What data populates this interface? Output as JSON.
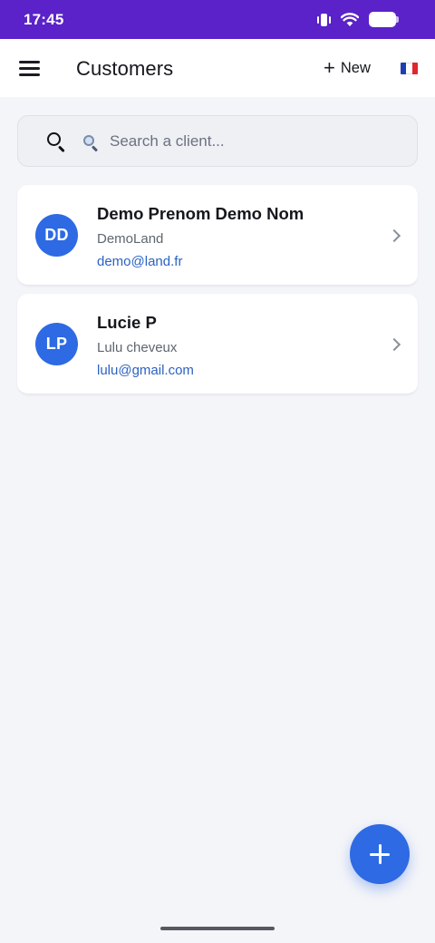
{
  "status_bar": {
    "time": "17:45",
    "icons": [
      "vibrate-icon",
      "wifi-icon",
      "battery-icon"
    ],
    "background_color": "#5a22c8"
  },
  "header": {
    "menu_icon": "menu-icon",
    "title": "Customers",
    "new_button": {
      "icon": "plus-icon",
      "label": "New"
    },
    "language_flag": "flag-fr-icon"
  },
  "search": {
    "placeholder": "Search a client...",
    "value": "",
    "icons": [
      "search-icon",
      "magnifier-emoji-icon"
    ]
  },
  "customers": [
    {
      "initials": "DD",
      "name": "Demo Prenom Demo Nom",
      "company": "DemoLand",
      "email": "demo@land.fr"
    },
    {
      "initials": "LP",
      "name": "Lucie P",
      "company": "Lulu cheveux",
      "email": "lulu@gmail.com"
    }
  ],
  "fab": {
    "icon": "plus-icon"
  },
  "colors": {
    "accent": "#2d6ae3",
    "email_link": "#2b62c2",
    "background": "#f4f5f9"
  }
}
